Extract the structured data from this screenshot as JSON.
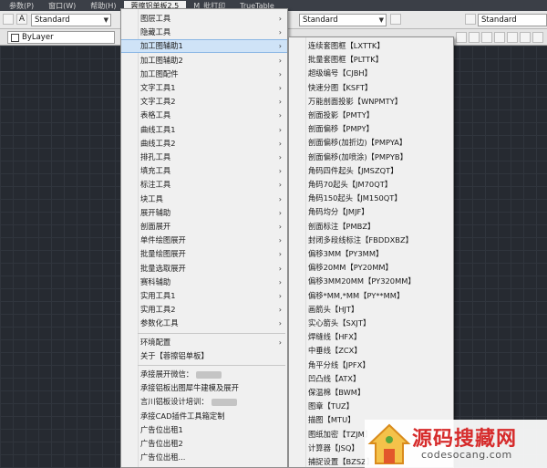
{
  "menubar": {
    "items": [
      "参数(P)",
      "窗口(W)",
      "帮助(H)",
      "蓉擦铝单板2.5",
      "M_批打印",
      "TrueTable"
    ]
  },
  "toolbar": {
    "text_style": "Standard",
    "dim_style": "Standard",
    "table_style": "Standard",
    "layer": "ByLayer"
  },
  "menu1": {
    "items": [
      {
        "label": "图层工具",
        "sub": true
      },
      {
        "label": "隐藏工具",
        "sub": true
      },
      {
        "label": "加工图辅助1",
        "sub": true,
        "highlighted": true
      },
      {
        "label": "加工图辅助2",
        "sub": true
      },
      {
        "label": "加工图配件",
        "sub": true
      },
      {
        "label": "文字工具1",
        "sub": true
      },
      {
        "label": "文字工具2",
        "sub": true
      },
      {
        "label": "表格工具",
        "sub": true
      },
      {
        "label": "曲线工具1",
        "sub": true
      },
      {
        "label": "曲线工具2",
        "sub": true
      },
      {
        "label": "排孔工具",
        "sub": true
      },
      {
        "label": "填充工具",
        "sub": true
      },
      {
        "label": "标注工具",
        "sub": true
      },
      {
        "label": "块工具",
        "sub": true
      },
      {
        "label": "展开辅助",
        "sub": true
      },
      {
        "label": "剖面展开",
        "sub": true
      },
      {
        "label": "单件绘图展开",
        "sub": true
      },
      {
        "label": "批量绘图展开",
        "sub": true
      },
      {
        "label": "批量选取展开",
        "sub": true
      },
      {
        "label": "赛科辅助",
        "sub": true
      },
      {
        "label": "实用工具1",
        "sub": true
      },
      {
        "label": "实用工具2",
        "sub": true
      },
      {
        "label": "参数化工具",
        "sub": true
      }
    ],
    "items2": [
      {
        "label": "环境配置",
        "sub": true
      },
      {
        "label": "关于【蓉擦铝单板】",
        "sub": false
      }
    ],
    "items3": [
      {
        "label": "承接展开微信：",
        "blur": true
      },
      {
        "label": "承接铝板出图犀牛建模及展开",
        "blur": false
      },
      {
        "label": "言川铝板设计培训：",
        "blur": true
      },
      {
        "label": "承接CAD插件工具箱定制",
        "blur": false
      },
      {
        "label": "广告位出租1",
        "blur": false
      },
      {
        "label": "广告位出租2",
        "blur": false
      },
      {
        "label": "广告位出租...",
        "blur": false
      }
    ]
  },
  "menu2": {
    "items": [
      "连续套图框【LXTTK】",
      "批量套图框【PLTTK】",
      "超级编号【CJBH】",
      "快速分图【KSFT】",
      "万能剖面投影【WNPMTY】",
      "剖面投影【PMTY】",
      "剖面偏移【PMPY】",
      "剖面偏移(加折边)【PMPYA】",
      "剖面偏移(加喷涂)【PMPYB】",
      "角码四件起头【JMSZQT】",
      "角码70起头【JM70QT】",
      "角码150起头【JM150QT】",
      "角码均分【JMJF】",
      "剖面标注【PMBZ】",
      "封闭多段线标注【FBDDXBZ】",
      "偏移3MM【PY3MM】",
      "偏移20MM【PY20MM】",
      "偏移3MM20MM【PY320MM】",
      "偏移*MM,*MM【PY**MM】",
      "画箭头【HJT】",
      "实心箭头【SXJT】",
      "焊缝线【HFX】",
      "中垂线【ZCX】",
      "角平分线【JPFX】",
      "凹凸线【ATX】",
      "保温棉【BWM】",
      "图章【TUZ】",
      "描图【MTU】",
      "图纸加密【TZJM】",
      "计算器【JSQ】",
      "捕捉设置【BZSZ】"
    ]
  },
  "watermark": {
    "title": "源码搜藏网",
    "url": "codesocang.com"
  },
  "colors": {
    "highlight": "#cfe3f7",
    "menu_bg": "#f0f0f0",
    "canvas_bg": "#262a31",
    "watermark_red": "#d62b2b"
  }
}
